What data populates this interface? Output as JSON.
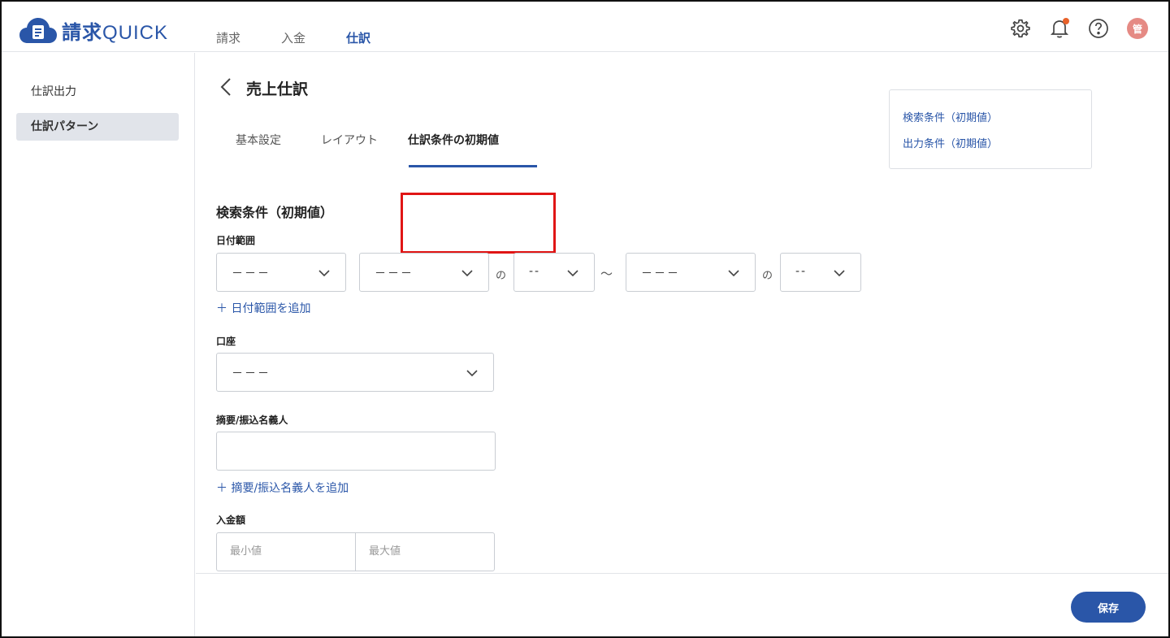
{
  "app": {
    "logo_kanji": "請求",
    "logo_latin": "QUICK"
  },
  "topnav": {
    "items": [
      {
        "label": "請求"
      },
      {
        "label": "入金"
      },
      {
        "label": "仕訳"
      }
    ],
    "active": "仕訳"
  },
  "header": {
    "avatar_initial": "管",
    "icons": [
      "gear-icon",
      "bell-icon",
      "help-icon"
    ],
    "notification_dot_color": "#e8622a"
  },
  "sidebar": {
    "items": [
      {
        "label": "仕訳出力"
      },
      {
        "label": "仕訳パターン"
      }
    ],
    "active": "仕訳パターン"
  },
  "page": {
    "title": "売上仕訳",
    "tabs": [
      {
        "label": "基本設定"
      },
      {
        "label": "レイアウト"
      },
      {
        "label": "仕訳条件の初期値"
      }
    ],
    "active_tab": "仕訳条件の初期値"
  },
  "search_section": {
    "title": "検索条件（初期値）",
    "date_range": {
      "label": "日付範囲",
      "from_year": "－－－",
      "from_month": "－－－",
      "from_day": "--",
      "to_year": "－－－",
      "to_day": "--",
      "no_sep": "の",
      "tilde": "〜",
      "add_link": "＋ 日付範囲を追加"
    },
    "account": {
      "label": "口座",
      "value": "－－－"
    },
    "memo": {
      "label": "摘要/振込名義人",
      "value": "",
      "add_link": "＋ 摘要/振込名義人を追加"
    },
    "amount": {
      "label": "入金額",
      "min_placeholder": "最小値",
      "max_placeholder": "最大値"
    }
  },
  "toc": {
    "links": [
      {
        "label": "検索条件（初期値）"
      },
      {
        "label": "出力条件（初期値）"
      }
    ]
  },
  "footer": {
    "save_label": "保存"
  },
  "colors": {
    "accent": "#2a56a8",
    "highlight": "#e01515",
    "sidebar_active_bg": "#e1e4ea"
  }
}
